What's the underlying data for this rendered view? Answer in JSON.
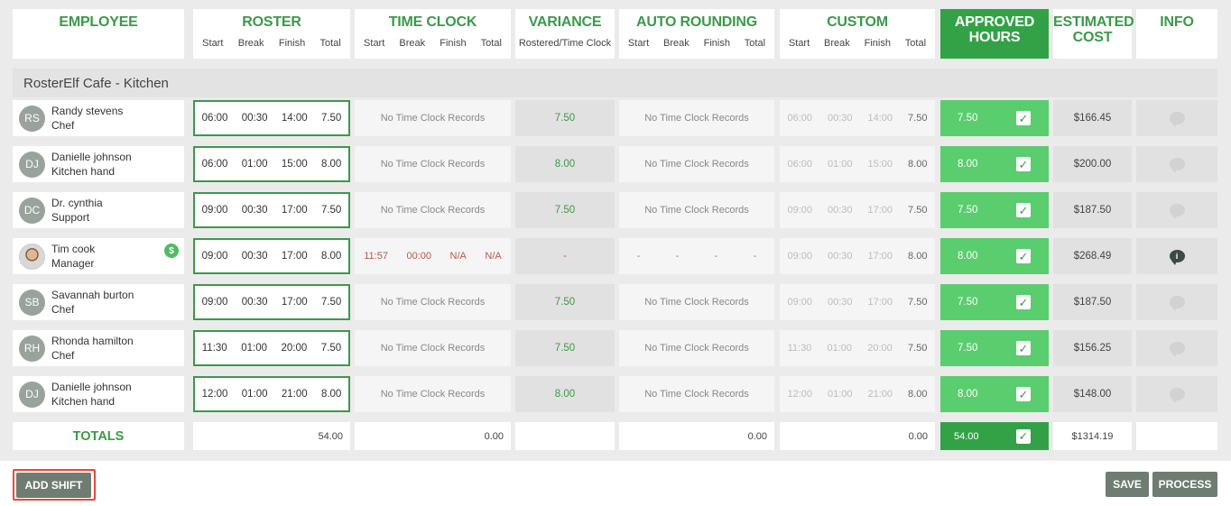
{
  "headers": {
    "employee": "EMPLOYEE",
    "roster": "ROSTER",
    "time_clock": "TIME CLOCK",
    "variance": "VARIANCE",
    "variance_sub": "Rostered/Time Clock",
    "auto_rounding": "AUTO ROUNDING",
    "custom": "CUSTOM",
    "approved_line1": "APPROVED",
    "approved_line2": "HOURS",
    "estimated_line1": "ESTIMATED",
    "estimated_line2": "COST",
    "info": "INFO",
    "sub_start": "Start",
    "sub_break": "Break",
    "sub_finish": "Finish",
    "sub_total": "Total"
  },
  "group_title": "RosterElf Cafe - Kitchen",
  "no_records_text": "No Time Clock Records",
  "rows": [
    {
      "initials": "RS",
      "name": "Randy stevens",
      "role": "Chef",
      "start": "06:00",
      "brk": "00:30",
      "finish": "14:00",
      "total": "7.50",
      "variance": "7.50",
      "c_start": "06:00",
      "c_break": "00:30",
      "c_finish": "14:00",
      "c_total": "7.50",
      "approved": "7.50",
      "cost": "$166.45"
    },
    {
      "initials": "DJ",
      "name": "Danielle johnson",
      "role": "Kitchen hand",
      "start": "06:00",
      "brk": "01:00",
      "finish": "15:00",
      "total": "8.00",
      "variance": "8.00",
      "c_start": "06:00",
      "c_break": "01:00",
      "c_finish": "15:00",
      "c_total": "8.00",
      "approved": "8.00",
      "cost": "$200.00"
    },
    {
      "initials": "DC",
      "name": "Dr. cynthia",
      "role": "Support",
      "start": "09:00",
      "brk": "00:30",
      "finish": "17:00",
      "total": "7.50",
      "variance": "7.50",
      "c_start": "09:00",
      "c_break": "00:30",
      "c_finish": "17:00",
      "c_total": "7.50",
      "approved": "7.50",
      "cost": "$187.50"
    },
    {
      "initials": "",
      "name": "Tim cook",
      "role": "Manager",
      "pay_badge": "$",
      "start": "09:00",
      "brk": "00:30",
      "finish": "17:00",
      "total": "8.00",
      "tc_start": "11:57",
      "tc_break": "00:00",
      "tc_finish": "N/A",
      "tc_total": "N/A",
      "variance": "-",
      "auto_dash": "-",
      "c_start": "09:00",
      "c_break": "00:30",
      "c_finish": "17:00",
      "c_total": "8.00",
      "approved": "8.00",
      "cost": "$268.49",
      "info_mark": "i"
    },
    {
      "initials": "SB",
      "name": "Savannah burton",
      "role": "Chef",
      "start": "09:00",
      "brk": "00:30",
      "finish": "17:00",
      "total": "7.50",
      "variance": "7.50",
      "c_start": "09:00",
      "c_break": "00:30",
      "c_finish": "17:00",
      "c_total": "7.50",
      "approved": "7.50",
      "cost": "$187.50"
    },
    {
      "initials": "RH",
      "name": "Rhonda hamilton",
      "role": "Chef",
      "start": "11:30",
      "brk": "01:00",
      "finish": "20:00",
      "total": "7.50",
      "variance": "7.50",
      "c_start": "11:30",
      "c_break": "01:00",
      "c_finish": "20:00",
      "c_total": "7.50",
      "approved": "7.50",
      "cost": "$156.25"
    },
    {
      "initials": "DJ",
      "name": "Danielle johnson",
      "role": "Kitchen hand",
      "start": "12:00",
      "brk": "01:00",
      "finish": "21:00",
      "total": "8.00",
      "variance": "8.00",
      "c_start": "12:00",
      "c_break": "01:00",
      "c_finish": "21:00",
      "c_total": "8.00",
      "approved": "8.00",
      "cost": "$148.00"
    }
  ],
  "totals": {
    "label": "TOTALS",
    "roster": "54.00",
    "time_clock": "0.00",
    "auto_rounding": "0.00",
    "custom": "0.00",
    "approved": "54.00",
    "cost": "$1314.19"
  },
  "buttons": {
    "add_shift": "ADD SHIFT",
    "save": "SAVE",
    "process": "PROCESS"
  },
  "colors": {
    "accent_green": "#3a9a48",
    "approved_green": "#5acd6e",
    "alert_red": "#c0574c",
    "highlight_red": "#e8483c"
  }
}
